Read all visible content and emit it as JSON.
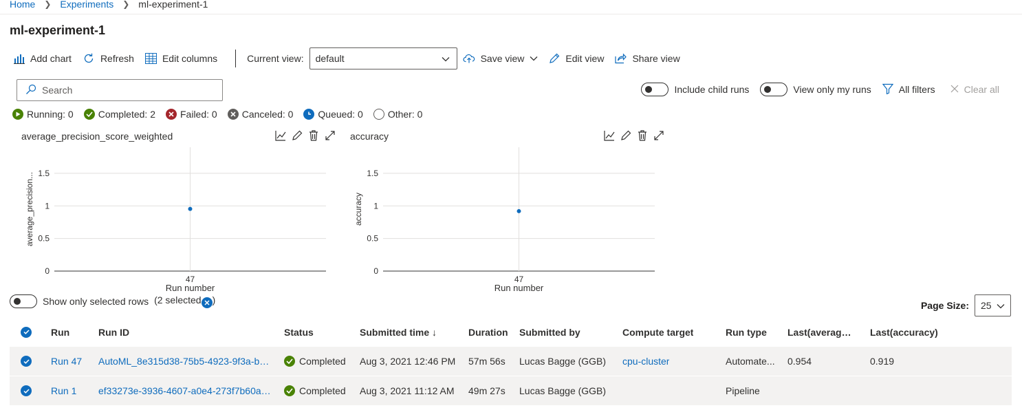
{
  "breadcrumb": {
    "home": "Home",
    "experiments": "Experiments",
    "current": "ml-experiment-1"
  },
  "page_title": "ml-experiment-1",
  "toolbar": {
    "add_chart": "Add chart",
    "refresh": "Refresh",
    "edit_columns": "Edit columns",
    "current_view_label": "Current view:",
    "current_view_value": "default",
    "save_view": "Save view",
    "edit_view": "Edit view",
    "share_view": "Share view"
  },
  "search": {
    "placeholder": "Search"
  },
  "filters": {
    "include_child_runs": "Include child runs",
    "view_only_my_runs": "View only my runs",
    "all_filters": "All filters",
    "clear_all": "Clear all"
  },
  "status_counts": {
    "running": "Running: 0",
    "completed": "Completed: 2",
    "failed": "Failed: 0",
    "canceled": "Canceled: 0",
    "queued": "Queued: 0",
    "other": "Other: 0"
  },
  "charts": [
    {
      "title": "average_precision_score_weighted",
      "chart_data": {
        "type": "scatter",
        "title": "average_precision_score_weighted",
        "xlabel": "Run number",
        "ylabel": "average_precision...",
        "categories": [
          "47"
        ],
        "y_ticks": [
          "0",
          "0.5",
          "1",
          "1.5"
        ],
        "ylim": [
          0,
          1.9
        ],
        "values": [
          0.954
        ],
        "grid": true,
        "color": "#0f6cbd"
      }
    },
    {
      "title": "accuracy",
      "chart_data": {
        "type": "scatter",
        "title": "accuracy",
        "xlabel": "Run number",
        "ylabel": "accuracy",
        "categories": [
          "47"
        ],
        "y_ticks": [
          "0",
          "0.5",
          "1",
          "1.5"
        ],
        "ylim": [
          0,
          1.9
        ],
        "values": [
          0.919
        ],
        "grid": true,
        "color": "#0f6cbd"
      }
    }
  ],
  "selection": {
    "show_only_selected": "Show only selected rows",
    "selected_open": "(2 selected",
    "selected_close": ")"
  },
  "page_size": {
    "label": "Page Size:",
    "value": "25"
  },
  "table": {
    "columns": [
      "Run",
      "Run ID",
      "Status",
      "Submitted time ↓",
      "Duration",
      "Submitted by",
      "Compute target",
      "Run type",
      "Last(average_...",
      "Last(accuracy)"
    ],
    "rows": [
      {
        "run": "Run 47",
        "run_id": "AutoML_8e315d38-75b5-4923-9f3a-b91...",
        "status": "Completed",
        "submitted_time": "Aug 3, 2021 12:46 PM",
        "duration": "57m 56s",
        "submitted_by": "Lucas Bagge (GGB)",
        "compute_target": "cpu-cluster",
        "run_type": "Automate...",
        "last_avg": "0.954",
        "last_acc": "0.919"
      },
      {
        "run": "Run 1",
        "run_id": "ef33273e-3936-4607-a0e4-273f7b60a13d",
        "status": "Completed",
        "submitted_time": "Aug 3, 2021 11:12 AM",
        "duration": "49m 27s",
        "submitted_by": "Lucas Bagge (GGB)",
        "compute_target": "",
        "run_type": "Pipeline",
        "last_avg": "",
        "last_acc": ""
      }
    ]
  },
  "colors": {
    "accent": "#0f6cbd",
    "completed": "#498205",
    "failed": "#a4262c",
    "canceled": "#605e5c"
  }
}
